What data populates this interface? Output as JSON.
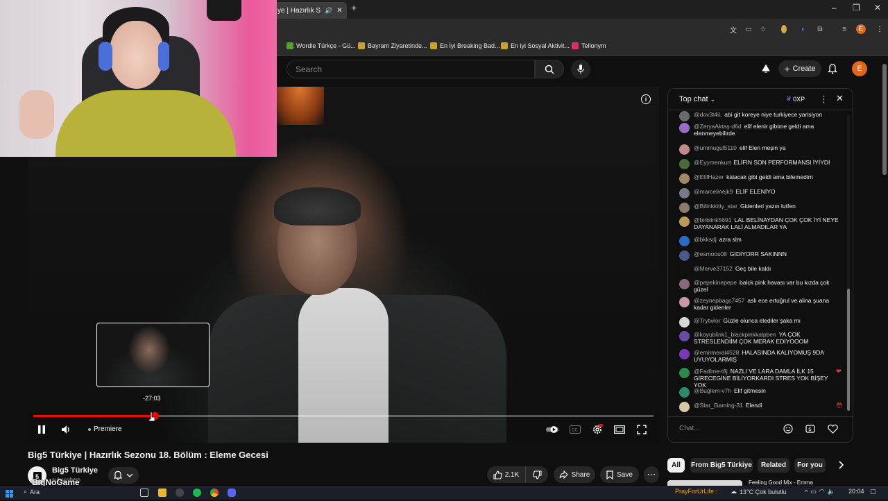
{
  "browser": {
    "active_tab_title": "ye | Hazırlık Sezo",
    "bookmarks": [
      {
        "label": "Wordle Türkçe - Gü...",
        "color": "#5aa02c"
      },
      {
        "label": "Bayram Ziyaretinde...",
        "color": "#c8a42a"
      },
      {
        "label": "En İyi Breaking Bad...",
        "color": "#c8a42a"
      },
      {
        "label": "En iyi Sosyal Aktivit...",
        "color": "#c8a42a"
      },
      {
        "label": "Tellonym",
        "color": "#e02a6a"
      }
    ],
    "profile_initial": "E"
  },
  "header": {
    "search_placeholder": "Search",
    "create_label": "Create",
    "avatar_initial": "E"
  },
  "player": {
    "preview_time": "-27:03",
    "premiere_label": "Premiere",
    "progress": 0.196
  },
  "video": {
    "title": "Big5 Türkiye | Hazırlık Sezonu 18. Bölüm : Eleme Gecesi",
    "channel_name": "Big5 Türkiye",
    "channel_subs": "subscribers",
    "watermark": "BigNoGame",
    "like_count": "2.1K",
    "share_label": "Share",
    "save_label": "Save"
  },
  "chat": {
    "title": "Top chat",
    "xp": "0XP",
    "input_placeholder": "Chat...",
    "messages": [
      {
        "author": "@dov3t4il.",
        "text": "abi git koreye niye turkiyece yarisiyon",
        "color": "#6b6b6b"
      },
      {
        "author": "@ZeryaAktaş-d6d",
        "text": "elif elenir gibime geldi ama elenmeyebilirde",
        "color": "#9a6ac8"
      },
      {
        "author": "@ummugul5110",
        "text": "elif Elen meşin ya",
        "color": "#c08a8a"
      },
      {
        "author": "@Eyymenkurt",
        "text": "ELİFİN SON PERFORMANSI İYİYDİ",
        "color": "#4a6a3a"
      },
      {
        "author": "@ElifHazer",
        "text": "kalacak gibi geldi ama bilemedim",
        "color": "#a08a6a"
      },
      {
        "author": "@marcelinejk9",
        "text": "ELİF ELENİYO",
        "color": "#7a7a8a"
      },
      {
        "author": "@Bilinkkitty_star",
        "text": "Gidenleri yazın lutfen",
        "color": "#8a7a6a"
      },
      {
        "author": "@birblink5691",
        "text": "LAL BELİNAYDAN ÇOK ÇOK İYİ NEYE DAYANARAK LALİ ALMADILAR YA",
        "color": "#b89a5a"
      },
      {
        "author": "@bkksdj",
        "text": "azra slm",
        "color": "#2a6ac8"
      },
      {
        "author": "@esmoos08",
        "text": "GIDIYORR SAKINNN",
        "color": "#4a5a8a"
      },
      {
        "author": "@Merve37152",
        "text": "Geç bile kaldı",
        "color": "#111111"
      },
      {
        "author": "@pepekinepepe",
        "text": "balck pink havası var bu kızda çok güzel",
        "color": "#8a6a7a"
      },
      {
        "author": "@zeynepbagc7457",
        "text": "aslı ece ertuğrul ve alina şuana kadar gidenler",
        "color": "#c89aa8"
      },
      {
        "author": "@Trytwlor",
        "text": "Güzle olunca elediler şaka mı",
        "color": "#d8d8d8"
      },
      {
        "author": "@koyublink1_blackpinkkalpben",
        "text": "YA ÇOK STRESLENDİİM ÇOK MERAK EDİYOOOM",
        "color": "#6a4aa8"
      },
      {
        "author": "@emirmeral4528",
        "text": "HALASINDA KALIYOMUŞ 9DA UYUYOLARMIŞ",
        "color": "#7a3ab8"
      },
      {
        "author": "@Fadlme-t8j",
        "text": "NAZLI VE LARA DAMLA İLK 15 GİRECEGİNE BİLİYORKARDI STRES YOK BİŞEY YOK",
        "color": "#2a8a4a",
        "emoji": "❤"
      },
      {
        "author": "@Buğlem-v7h",
        "text": "Elif gitmesin",
        "color": "#2a8a6a"
      },
      {
        "author": "@Star_Gaming-31",
        "text": "Elendi",
        "color": "#d8c8a8",
        "emoji": "😳"
      }
    ]
  },
  "chips": [
    "All",
    "From Big5 Türkiye",
    "Related",
    "For you"
  ],
  "rec_title": "Feeling Good Mix - Emma",
  "taskbar": {
    "search_label": "Ara",
    "news_text": "PrayForUrLife :",
    "weather": "13°C  Çok bulutlu",
    "time": "20:04"
  },
  "colors": {
    "accent_red": "#ff0000",
    "bg": "#0f0f0f",
    "chip_bg": "#272727"
  }
}
